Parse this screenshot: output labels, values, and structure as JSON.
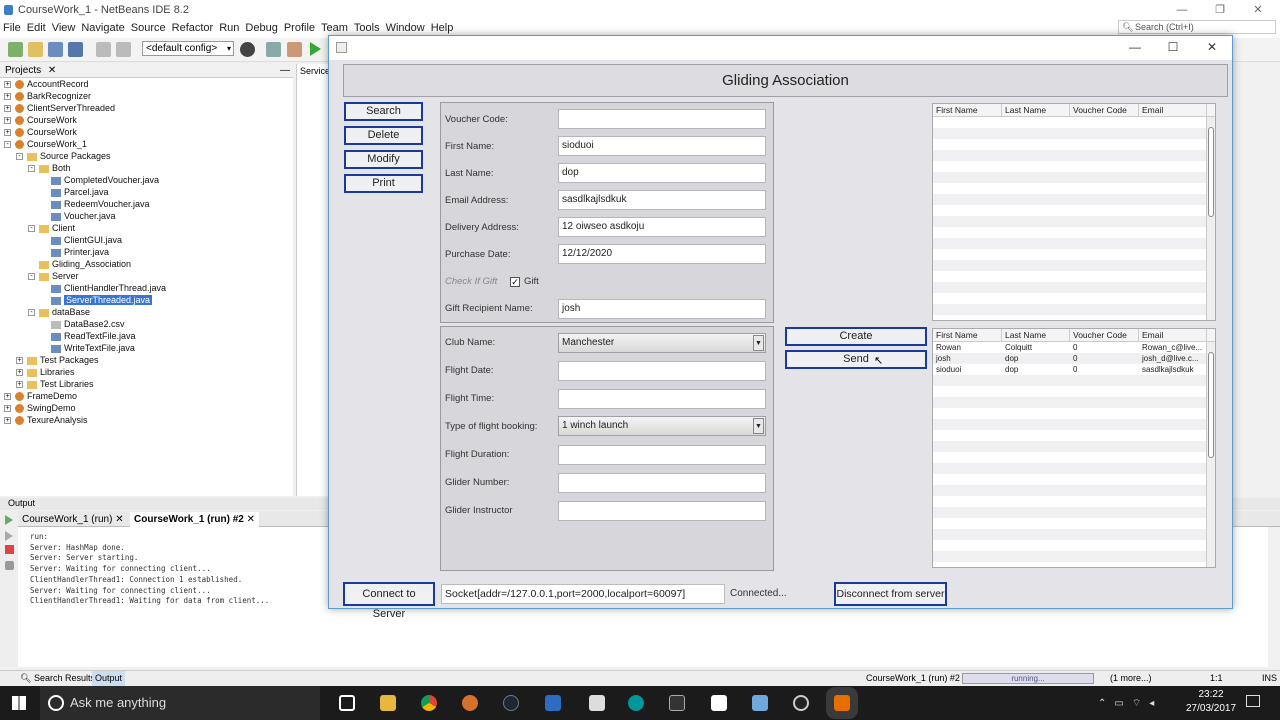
{
  "ide": {
    "title": "CourseWork_1 - NetBeans IDE 8.2",
    "menu": [
      "File",
      "Edit",
      "View",
      "Navigate",
      "Source",
      "Refactor",
      "Run",
      "Debug",
      "Profile",
      "Team",
      "Tools",
      "Window",
      "Help"
    ],
    "config": "<default config>",
    "search_placeholder": "Search (Ctrl+I)",
    "projects_tab": "Projects",
    "services_tab": "Services",
    "tree": [
      {
        "label": "AccountRecord",
        "depth": 0,
        "toggle": "+",
        "icon": "project"
      },
      {
        "label": "BarkRecognizer",
        "depth": 0,
        "toggle": "+",
        "icon": "project"
      },
      {
        "label": "ClientServerThreaded",
        "depth": 0,
        "toggle": "+",
        "icon": "project"
      },
      {
        "label": "CourseWork",
        "depth": 0,
        "toggle": "+",
        "icon": "project"
      },
      {
        "label": "CourseWork",
        "depth": 0,
        "toggle": "+",
        "icon": "project"
      },
      {
        "label": "CourseWork_1",
        "depth": 0,
        "toggle": "-",
        "icon": "project"
      },
      {
        "label": "Source Packages",
        "depth": 1,
        "toggle": "-",
        "icon": "folder"
      },
      {
        "label": "Both",
        "depth": 2,
        "toggle": "-",
        "icon": "package"
      },
      {
        "label": "CompletedVoucher.java",
        "depth": 3,
        "toggle": "",
        "icon": "java"
      },
      {
        "label": "Parcel.java",
        "depth": 3,
        "toggle": "",
        "icon": "java"
      },
      {
        "label": "RedeemVoucher.java",
        "depth": 3,
        "toggle": "",
        "icon": "java"
      },
      {
        "label": "Voucher.java",
        "depth": 3,
        "toggle": "",
        "icon": "java"
      },
      {
        "label": "Client",
        "depth": 2,
        "toggle": "-",
        "icon": "package"
      },
      {
        "label": "ClientGUI.java",
        "depth": 3,
        "toggle": "",
        "icon": "java"
      },
      {
        "label": "Printer.java",
        "depth": 3,
        "toggle": "",
        "icon": "java"
      },
      {
        "label": "Gliding_Association",
        "depth": 2,
        "toggle": "",
        "icon": "package"
      },
      {
        "label": "Server",
        "depth": 2,
        "toggle": "-",
        "icon": "package"
      },
      {
        "label": "ClientHandlerThread.java",
        "depth": 3,
        "toggle": "",
        "icon": "java"
      },
      {
        "label": "ServerThreaded.java",
        "depth": 3,
        "toggle": "",
        "icon": "java",
        "selected": true
      },
      {
        "label": "dataBase",
        "depth": 2,
        "toggle": "-",
        "icon": "package"
      },
      {
        "label": "DataBase2.csv",
        "depth": 3,
        "toggle": "",
        "icon": "file"
      },
      {
        "label": "ReadTextFile.java",
        "depth": 3,
        "toggle": "",
        "icon": "java"
      },
      {
        "label": "WriteTextFile.java",
        "depth": 3,
        "toggle": "",
        "icon": "java"
      },
      {
        "label": "Test Packages",
        "depth": 1,
        "toggle": "+",
        "icon": "folder"
      },
      {
        "label": "Libraries",
        "depth": 1,
        "toggle": "+",
        "icon": "folder"
      },
      {
        "label": "Test Libraries",
        "depth": 1,
        "toggle": "+",
        "icon": "folder"
      },
      {
        "label": "FrameDemo",
        "depth": 0,
        "toggle": "+",
        "icon": "project"
      },
      {
        "label": "SwingDemo",
        "depth": 0,
        "toggle": "+",
        "icon": "project"
      },
      {
        "label": "TexureAnalysis",
        "depth": 0,
        "toggle": "+",
        "icon": "project"
      }
    ],
    "output_title": "Output",
    "output_tabs": [
      "CourseWork_1 (run)",
      "CourseWork_1 (run) #2"
    ],
    "output_lines": [
      "run:",
      "Server: HashMap done.",
      "Server: Server starting.",
      "Server: Waiting for connecting client...",
      "ClientHandlerThread1: Connection 1 established.",
      "Server: Waiting for connecting client...",
      "ClientHandlerThread1: Waiting for data from client..."
    ],
    "status": {
      "search_results": "Search Results",
      "output": "Output",
      "run_label": "CourseWork_1 (run) #2",
      "progress_text": "running...",
      "more": "(1 more...)",
      "position": "1:1",
      "mode": "INS"
    }
  },
  "taskbar": {
    "cortana": "Ask me anything",
    "time": "23:22",
    "date": "27/03/2017"
  },
  "app": {
    "heading": "Gliding Association",
    "buttons": {
      "search": "Search",
      "delete": "Delete",
      "modify": "Modify",
      "print": "Print",
      "create": "Create",
      "send": "Send",
      "connect": "Connect to Server",
      "disconnect": "Disconnect from server"
    },
    "voucher": {
      "voucher_code_label": "Voucher Code:",
      "voucher_code": "",
      "first_name_label": "First Name:",
      "first_name": "sioduoi",
      "last_name_label": "Last Name:",
      "last_name": "dop",
      "email_label": "Email Address:",
      "email": "sasdlkajlsdkuk",
      "delivery_label": "Delivery Address:",
      "delivery": "12 oiwseo asdkoju",
      "purchase_label": "Purchase Date:",
      "purchase": "12/12/2020",
      "gift_check_label": "Check If Gift",
      "gift_label": "Gift",
      "recipient_label": "Gift Recipient Name:",
      "recipient": "josh"
    },
    "flight": {
      "club_label": "Club Name:",
      "club": "Manchester",
      "date_label": "Flight Date:",
      "date": "",
      "time_label": "Flight Time:",
      "time": "",
      "type_label": "Type of flight booking:",
      "type": "1 winch launch",
      "duration_label": "Flight Duration:",
      "duration": "",
      "glider_label": "Glider Number:",
      "glider": "",
      "instructor_label": "Glider Instructor",
      "instructor": ""
    },
    "table_columns": [
      "First Name",
      "Last Name",
      "Voucher Code",
      "Email"
    ],
    "table_rows": [
      [
        "Rowan",
        "Colquitt",
        "0",
        "Rowan_c@live..."
      ],
      [
        "josh",
        "dop",
        "0",
        "josh_d@live.c..."
      ],
      [
        "sioduoi",
        "dop",
        "0",
        "sasdlkajlsdkuk"
      ]
    ],
    "connection_info": "Socket[addr=/127.0.0.1,port=2000,localport=60097]",
    "connection_status": "Connected..."
  }
}
